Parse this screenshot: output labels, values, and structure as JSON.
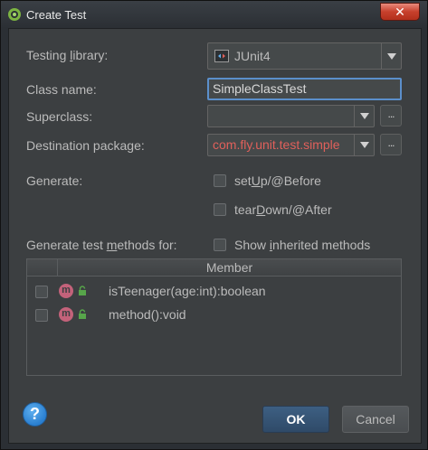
{
  "window": {
    "title": "Create Test",
    "close_symbol": "✕"
  },
  "form": {
    "testing_library": {
      "label_pre": "Testing ",
      "label_u": "l",
      "label_post": "ibrary:",
      "value": "JUnit4"
    },
    "class_name": {
      "label": "Class name:",
      "value": "SimpleClassTest"
    },
    "superclass": {
      "label": "Superclass:",
      "value": "",
      "browse": "..."
    },
    "destination_package": {
      "label": "Destination package:",
      "value": "com.fly.unit.test.simple",
      "value_color": "#e0605b",
      "browse": "..."
    },
    "generate": {
      "label": "Generate:",
      "setup": {
        "pre": "set",
        "u": "U",
        "post": "p/@Before"
      },
      "teardown": {
        "pre": "tear",
        "u": "D",
        "post": "own/@After"
      }
    },
    "methods_for": {
      "label_pre": "Generate test ",
      "label_u": "m",
      "label_post": "ethods for:"
    },
    "show_inherited": {
      "pre": "Show ",
      "u": "i",
      "post": "nherited methods"
    }
  },
  "table": {
    "header": "Member",
    "rows": [
      {
        "badge": "m",
        "name": "isTeenager(age:int):boolean"
      },
      {
        "badge": "m",
        "name": "method():void"
      }
    ]
  },
  "footer": {
    "help": "?",
    "ok": "OK",
    "cancel": "Cancel"
  },
  "colors": {
    "accent": "#5b8fcb",
    "error_text": "#e0605b",
    "background": "#3c3f41"
  }
}
